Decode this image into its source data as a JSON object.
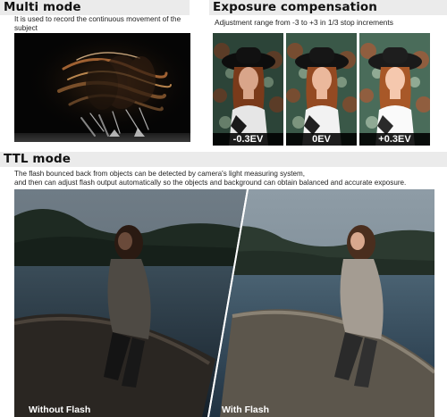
{
  "multi": {
    "title": "Multi mode",
    "description": "It is used to record the continuous movement of the subject"
  },
  "exposure": {
    "title": "Exposure compensation",
    "description": "Adjustment range from -3 to +3 in 1/3 stop increments",
    "steps": [
      "-0.3EV",
      "0EV",
      "+0.3EV"
    ]
  },
  "ttl": {
    "title": "TTL mode",
    "description_line1": "The flash bounced back from objects can be detected by camera's light measuring system,",
    "description_line2": "and then can adjust flash  output automatically so the objects and background can obtain balanced and accurate exposure.",
    "without_label": "Without Flash",
    "with_label": "With Flash"
  }
}
